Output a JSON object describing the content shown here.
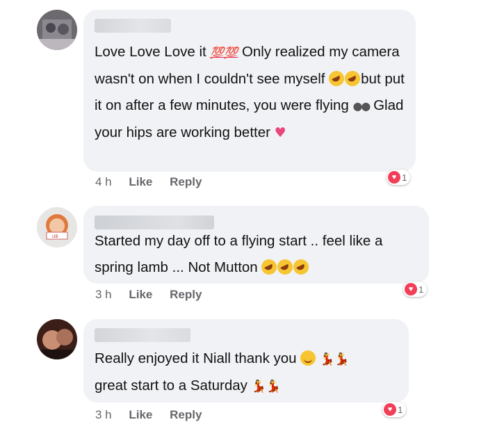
{
  "comments": [
    {
      "author": "",
      "text_parts": [
        "Love Love Love it ",
        "💯💯",
        " Only realized my camera wasn't on when I couldn't see myself ",
        "🤣🤣",
        "but put it on after a few minutes, you were flying ",
        "👀",
        " Glad your hips are working better ",
        "💖"
      ],
      "time": "4 h",
      "like_label": "Like",
      "reply_label": "Reply",
      "reactions": {
        "icon": "heart-icon",
        "count": "1"
      }
    },
    {
      "author": "",
      "text_parts": [
        "Started my day off to a flying start .. feel like a spring lamb ...  Not  Mutton ",
        "🤣🤣🤣"
      ],
      "time": "3 h",
      "like_label": "Like",
      "reply_label": "Reply",
      "reactions": {
        "icon": "heart-icon",
        "count": "1"
      }
    },
    {
      "author": "",
      "text_parts": [
        "Really enjoyed it Niall thank you ",
        "😊",
        "💃💃",
        "great start to a Saturday ",
        "💃💃"
      ],
      "time": "3 h",
      "like_label": "Like",
      "reply_label": "Reply",
      "reactions": {
        "icon": "heart-icon",
        "count": "1"
      }
    }
  ],
  "colors": {
    "bubble": "#f0f2f5",
    "meta_text": "#65676b",
    "reaction_heart": "#f33e58"
  }
}
